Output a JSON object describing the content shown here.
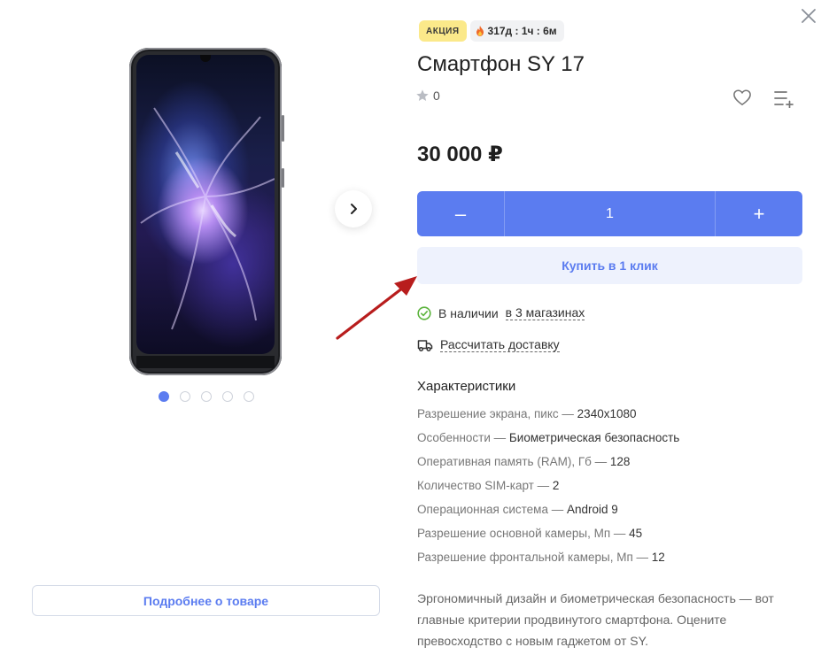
{
  "modal": {
    "close_icon": "close-icon"
  },
  "gallery": {
    "image_alt": "smartphone-photo",
    "next_icon": "chevron-right-icon",
    "dots": [
      {
        "active": true
      },
      {
        "active": false
      },
      {
        "active": false
      },
      {
        "active": false
      },
      {
        "active": false
      }
    ],
    "more_button_label": "Подробнее о товаре"
  },
  "product": {
    "badge_sale": "АКЦИЯ",
    "timer": "317д : 1ч : 6м",
    "timer_icon": "fire-icon",
    "title": "Смартфон SY 17",
    "rating_icon": "star-icon",
    "rating_count": "0",
    "favorite_icon": "heart-icon",
    "compare_icon": "add-to-list-icon",
    "price": "30 000 ₽"
  },
  "cart": {
    "minus": "–",
    "quantity": "1",
    "plus": "+",
    "one_click_label": "Купить в 1 клик"
  },
  "availability": {
    "icon": "check-circle-icon",
    "text": "В наличии",
    "link": "в 3 магазинах"
  },
  "delivery": {
    "icon": "truck-icon",
    "link": "Рассчитать доставку"
  },
  "specs": {
    "title": "Характеристики",
    "items": [
      {
        "name": "Разрешение экрана, пикс",
        "value": "2340x1080"
      },
      {
        "name": "Особенности",
        "value": "Биометрическая безопасность"
      },
      {
        "name": "Оперативная память (RAM), Гб",
        "value": "128"
      },
      {
        "name": "Количество SIM-карт",
        "value": "2"
      },
      {
        "name": "Операционная система",
        "value": "Android 9"
      },
      {
        "name": "Разрешение основной камеры, Мп",
        "value": "45"
      },
      {
        "name": "Разрешение фронтальной камеры, Мп",
        "value": "12"
      }
    ]
  },
  "description": "Эргономичный дизайн и биометрическая безопасность — вот главные критерии продвинутого смартфона. Оцените превосходство с новым гаджетом от SY.",
  "colors": {
    "accent": "#5b7cf0",
    "sale_badge": "#fbe98a",
    "annotation_arrow": "#b81d1d",
    "in_stock": "#5bb33c"
  }
}
